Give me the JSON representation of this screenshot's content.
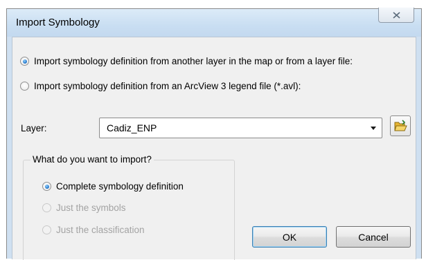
{
  "window": {
    "title": "Import Symbology"
  },
  "source_options": [
    {
      "label": "Import symbology definition from another layer in the map or from a layer file:",
      "checked": true
    },
    {
      "label": "Import symbology definition from an ArcView 3 legend file (*.avl):",
      "checked": false
    }
  ],
  "layer": {
    "label": "Layer:",
    "value": "Cadiz_ENP"
  },
  "import_group": {
    "title": "What do you want to import?",
    "options": [
      {
        "label": "Complete symbology definition",
        "checked": true,
        "enabled": true
      },
      {
        "label": "Just the symbols",
        "checked": false,
        "enabled": false
      },
      {
        "label": "Just the classification",
        "checked": false,
        "enabled": false
      }
    ]
  },
  "buttons": {
    "ok_label": "OK",
    "cancel_label": "Cancel"
  },
  "icons": {
    "close": "close-icon",
    "dropdown": "chevron-down-icon",
    "browse": "open-folder-icon"
  },
  "colors": {
    "frame": "#cfe0f1",
    "client": "#f0f0f0",
    "radio_dot": "#1d6fc4",
    "folder": "#f2c94c"
  }
}
